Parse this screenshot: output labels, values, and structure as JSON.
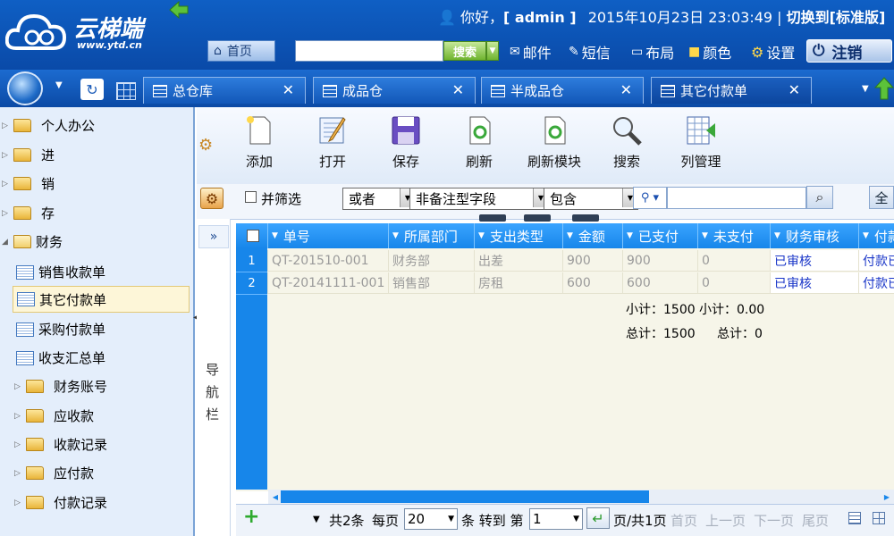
{
  "header": {
    "logo_text": "云梯端",
    "logo_url": "www.ytd.cn",
    "greeting": "你好，",
    "user": "[ admin ]",
    "datetime": "2015年10月23日  23:03:49",
    "switch_label": "切换到[标准版]",
    "home_label": "首页",
    "search_value": "",
    "search_button": "搜索",
    "links": [
      "邮件",
      "短信",
      "布局",
      "颜色",
      "设置"
    ],
    "logout_label": "注销"
  },
  "tabs": [
    {
      "label": "总仓库"
    },
    {
      "label": "成品仓"
    },
    {
      "label": "半成品仓"
    },
    {
      "label": "其它付款单"
    }
  ],
  "sidebar": {
    "items": [
      {
        "label": "个人办公",
        "kind": "folder"
      },
      {
        "label": "进",
        "kind": "folder"
      },
      {
        "label": "销",
        "kind": "folder"
      },
      {
        "label": "存",
        "kind": "folder"
      },
      {
        "label": "财务",
        "kind": "folder-open"
      },
      {
        "label": "销售收款单",
        "kind": "doc"
      },
      {
        "label": "其它付款单",
        "kind": "doc"
      },
      {
        "label": "采购付款单",
        "kind": "doc"
      },
      {
        "label": "收支汇总单",
        "kind": "doc"
      },
      {
        "label": "财务账号",
        "kind": "folder"
      },
      {
        "label": "应收款",
        "kind": "folder"
      },
      {
        "label": "收款记录",
        "kind": "folder"
      },
      {
        "label": "应付款",
        "kind": "folder"
      },
      {
        "label": "付款记录",
        "kind": "folder"
      }
    ]
  },
  "nav_strip": {
    "chevron": "»",
    "label": "导航栏"
  },
  "toolbar": {
    "buttons": [
      "添加",
      "打开",
      "保存",
      "刷新",
      "刷新模块",
      "搜索",
      "列管理"
    ]
  },
  "filter": {
    "checkbox_label": "并筛选",
    "logic": "或者",
    "field": "非备注型字段",
    "operator": "包含",
    "value": "",
    "all_label": "全"
  },
  "grid": {
    "columns": [
      "单号",
      "所属部门",
      "支出类型",
      "金额",
      "已支付",
      "未支付",
      "财务审核",
      "付款审核"
    ],
    "rows": [
      {
        "num": "1",
        "cells": [
          "QT-201510-001",
          "财务部",
          "出差",
          "900",
          "900",
          "0",
          "已审核",
          "付款已审核"
        ]
      },
      {
        "num": "2",
        "cells": [
          "QT-20141111-001",
          "销售部",
          "房租",
          "600",
          "600",
          "0",
          "已审核",
          "付款已审核"
        ]
      }
    ],
    "subtotal_label_1": "小计：",
    "subtotal_value_1": "1500",
    "subtotal_label_2": "小计：",
    "subtotal_value_2": "0.00",
    "total_label_1": "总计：",
    "total_value_1": "1500",
    "total_label_2": "总计：",
    "total_value_2": "0"
  },
  "pager": {
    "total": "共2条",
    "per_page_label": "每页",
    "per_page": "20",
    "goto_label": "条 转到 第",
    "page": "1",
    "page_of": "页/共1页",
    "first": "首页",
    "prev": "上一页",
    "next": "下一页",
    "last": "尾页"
  },
  "colors": {
    "header_blue": "#0f5fc4",
    "grid_header": "#1786ea",
    "approved_text": "#1a36c8"
  }
}
